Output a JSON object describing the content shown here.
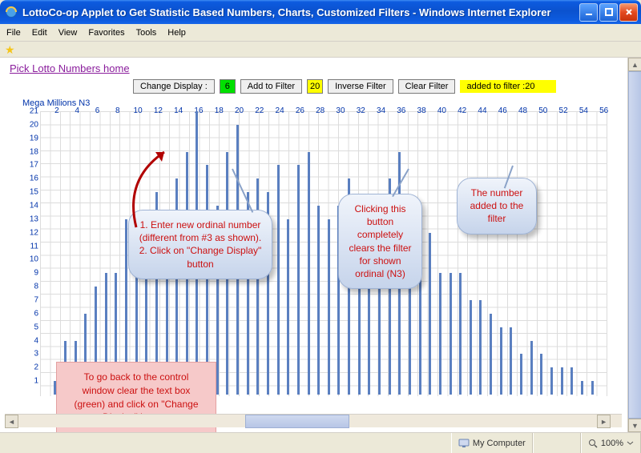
{
  "window": {
    "title": "LottoCo-op Applet to Get Statistic Based Numbers, Charts, Customized Filters - Windows Internet Explorer"
  },
  "menubar": [
    "File",
    "Edit",
    "View",
    "Favorites",
    "Tools",
    "Help"
  ],
  "page": {
    "home_link": "Pick Lotto Numbers home",
    "chart_title": "Mega Millions N3",
    "toolbar": {
      "change_display": "Change Display :",
      "ordinal_value": "6",
      "add_to_filter": "Add to Filter",
      "filter_value": "20",
      "inverse_filter": "Inverse Filter",
      "clear_filter": "Clear Filter",
      "status_msg": "added to filter :20"
    }
  },
  "annotations": {
    "enter_ordinal": "1. Enter  new ordinal number (different from #3 as shown).\n2. Click on \"Change Display\" button",
    "clear_filter": "Clicking this button completely clears the filter for shown ordinal (N3)",
    "added": "The number added to the filter",
    "go_back": "To go back to the control window clear the text box (green) and click on \"Change Display\" button."
  },
  "status": {
    "zone": "My Computer",
    "zoom": "100%"
  },
  "chart_data": {
    "type": "bar",
    "title": "Mega Millions N3",
    "xlabel": "",
    "ylabel": "",
    "ylim": [
      0,
      21
    ],
    "yticks": [
      1,
      2,
      3,
      4,
      5,
      6,
      7,
      8,
      9,
      10,
      11,
      12,
      13,
      14,
      15,
      16,
      17,
      18,
      19,
      20,
      21
    ],
    "xticks": [
      2,
      4,
      6,
      8,
      10,
      12,
      14,
      16,
      18,
      20,
      22,
      24,
      26,
      28,
      30,
      32,
      34,
      36,
      38,
      40,
      42,
      44,
      46,
      48,
      50,
      52,
      54,
      56
    ],
    "categories": [
      1,
      2,
      3,
      4,
      5,
      6,
      7,
      8,
      9,
      10,
      11,
      12,
      13,
      14,
      15,
      16,
      17,
      18,
      19,
      20,
      21,
      22,
      23,
      24,
      25,
      26,
      27,
      28,
      29,
      30,
      31,
      32,
      33,
      34,
      35,
      36,
      37,
      38,
      39,
      40,
      41,
      42,
      43,
      44,
      45,
      46,
      47,
      48,
      49,
      50,
      51,
      52,
      53,
      54,
      55,
      56
    ],
    "values": [
      0,
      1,
      4,
      4,
      6,
      8,
      9,
      9,
      13,
      13,
      10,
      15,
      11,
      16,
      18,
      21,
      17,
      14,
      18,
      20,
      15,
      16,
      15,
      17,
      13,
      17,
      18,
      14,
      13,
      14,
      16,
      10,
      14,
      12,
      16,
      18,
      14,
      10,
      12,
      9,
      9,
      9,
      7,
      7,
      6,
      5,
      5,
      3,
      4,
      3,
      2,
      2,
      2,
      1,
      1,
      0
    ]
  }
}
